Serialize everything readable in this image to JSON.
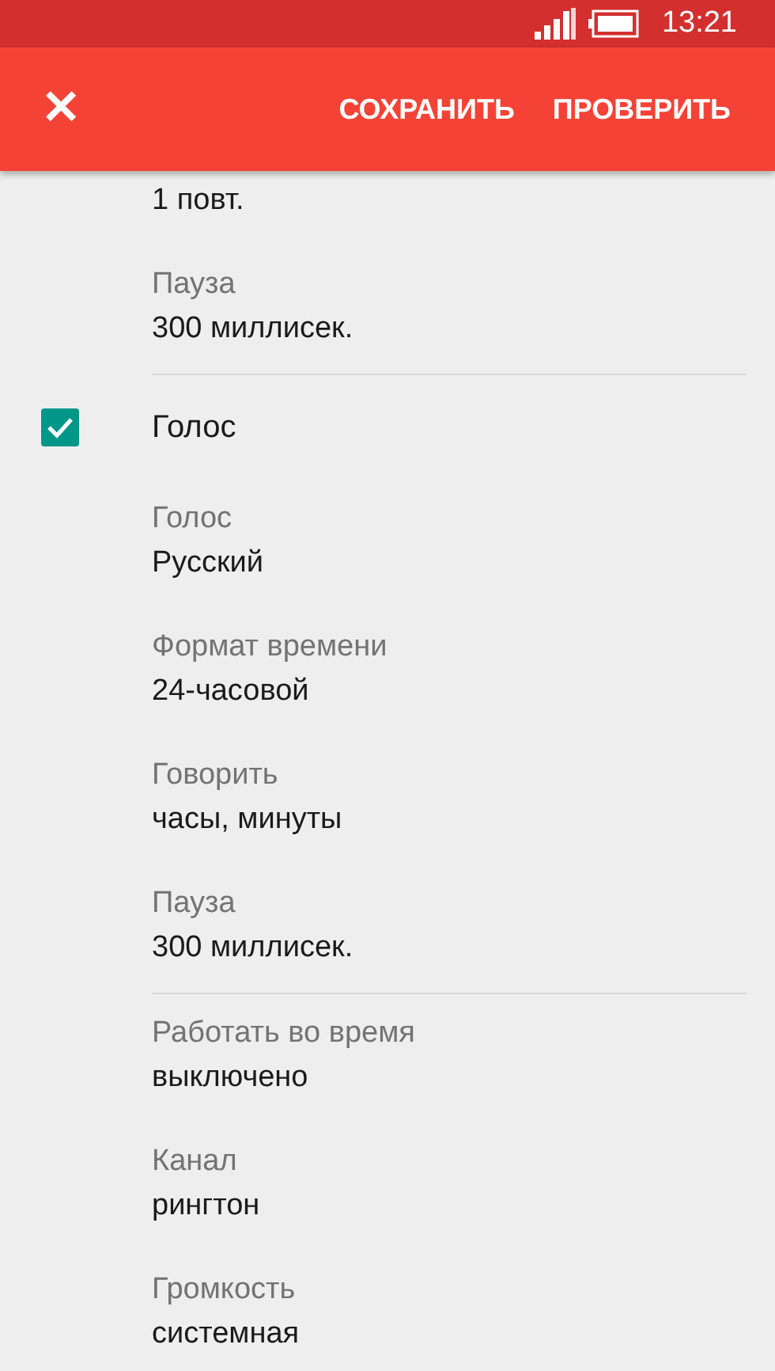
{
  "status_bar": {
    "time": "13:21"
  },
  "toolbar": {
    "close": "✕",
    "actions": [
      {
        "label": "СОХРАНИТЬ"
      },
      {
        "label": "ПРОВЕРИТЬ"
      }
    ]
  },
  "sections": [
    {
      "items": [
        {
          "kind": "setting",
          "value": "1 повт."
        },
        {
          "kind": "setting",
          "label": "Пауза",
          "value": "300 миллисек."
        }
      ]
    },
    {
      "items": [
        {
          "kind": "checkbox",
          "label": "Голос",
          "checked": true
        },
        {
          "kind": "setting",
          "label": "Голос",
          "value": "Русский"
        },
        {
          "kind": "setting",
          "label": "Формат времени",
          "value": "24-часовой"
        },
        {
          "kind": "setting",
          "label": "Говорить",
          "value": "часы, минуты"
        },
        {
          "kind": "setting",
          "label": "Пауза",
          "value": "300 миллисек."
        }
      ]
    },
    {
      "items": [
        {
          "kind": "setting",
          "label": "Работать во время",
          "value": "выключено"
        },
        {
          "kind": "setting",
          "label": "Канал",
          "value": "рингтон"
        },
        {
          "kind": "setting",
          "label": "Громкость",
          "value": "системная"
        }
      ]
    }
  ]
}
